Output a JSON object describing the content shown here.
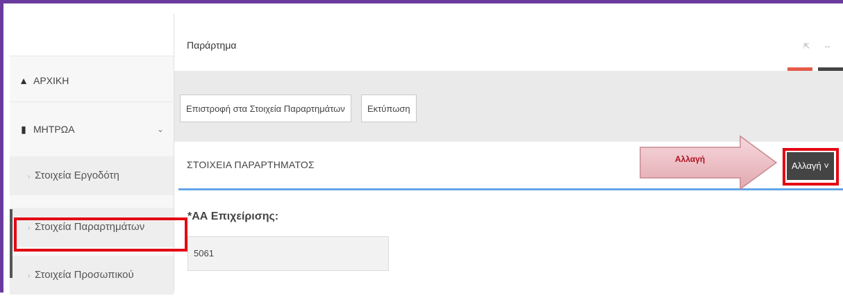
{
  "sidebar": {
    "items": [
      {
        "label": "ΑΡΧΙΚΗ",
        "icon": "home-icon"
      },
      {
        "label": "ΜΗΤΡΩΑ",
        "icon": "book-icon"
      }
    ],
    "submenu": [
      {
        "label": "Στοιχεία Εργοδότη"
      },
      {
        "label": "Στοιχεία Παραρτημάτων"
      },
      {
        "label": "Στοιχεία Προσωπικού"
      }
    ]
  },
  "header": {
    "title": "Παράρτημα"
  },
  "toolbar": {
    "back_label": "Επιστροφή στα Στοιχεία Παραρτημάτων",
    "print_label": "Εκτύπωση"
  },
  "panel": {
    "title": "ΣΤΟΙΧΕΙΑ ΠΑΡΑΡΤΗΜΑΤΟΣ",
    "change_label": "Αλλαγή",
    "callout_label": "Αλλαγή"
  },
  "form": {
    "label": "*ΑΑ Επιχείρισης:",
    "value": "5061"
  },
  "colors": {
    "frame": "#6a3b9e",
    "highlight": "#e30613",
    "panel_underline": "#63a6e8",
    "accent_red": "#e35b4a",
    "accent_dark": "#444444"
  }
}
